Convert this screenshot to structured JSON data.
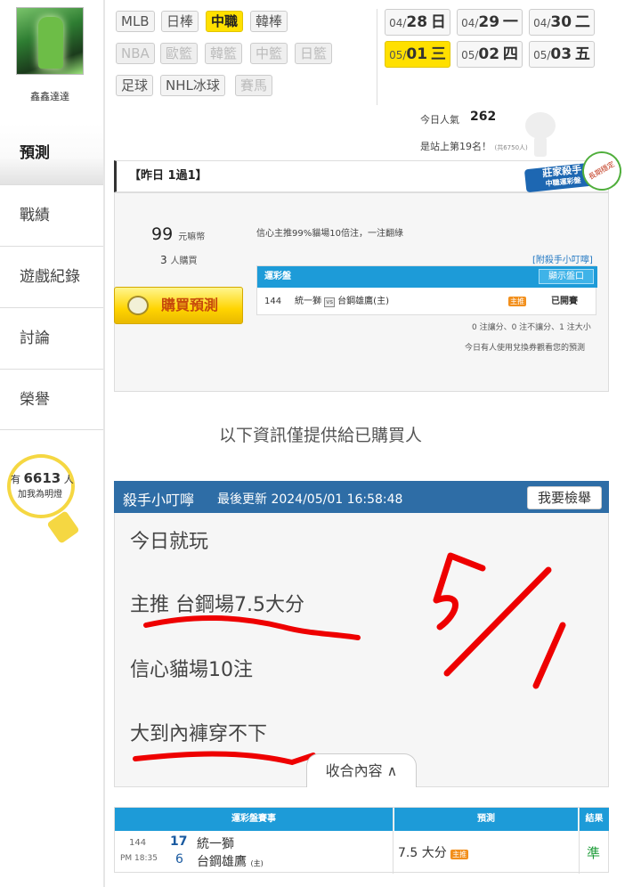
{
  "user": {
    "name": "鑫鑫達達"
  },
  "nav": [
    {
      "label": "預測"
    },
    {
      "label": "戰績"
    },
    {
      "label": "遊戲紀錄"
    },
    {
      "label": "討論"
    },
    {
      "label": "榮譽"
    }
  ],
  "lamp": {
    "prefix": "有",
    "count": "6613",
    "suffix": "人",
    "line2": "加我為明燈"
  },
  "sports": [
    "MLB",
    "日棒",
    "中職",
    "韓棒",
    "NBA",
    "歐籃",
    "韓籃",
    "中籃",
    "日籃",
    "足球",
    "NHL冰球",
    "賽馬"
  ],
  "dates": [
    {
      "md": "04/",
      "d": "28",
      "wd": "日"
    },
    {
      "md": "04/",
      "d": "29",
      "wd": "一"
    },
    {
      "md": "04/",
      "d": "30",
      "wd": "二"
    },
    {
      "md": "05/",
      "d": "01",
      "wd": "三"
    },
    {
      "md": "05/",
      "d": "02",
      "wd": "四"
    },
    {
      "md": "05/",
      "d": "03",
      "wd": "五"
    }
  ],
  "stats": {
    "pop_label": "今日人氣",
    "pop_value": "262",
    "rank_text": "是站上第19名！",
    "rank_sub": "(共6750人)"
  },
  "yesterday": "【昨日 1過1】",
  "badge": {
    "title": "莊家殺手",
    "sub": "中職運彩盤",
    "circle": "長期穩定"
  },
  "purchase": {
    "price": "99",
    "price_unit": "元嘛幣",
    "buyers": "3",
    "buyers_unit": "人購買",
    "button": "購買預測"
  },
  "pitch": "信心主推99%貓場10倍注，一注翻綠",
  "tip_link": "[附殺手小叮嚀]",
  "table1": {
    "header": "運彩盤",
    "toggle": "顯示盤口",
    "num": "144",
    "team_a": "統一獅",
    "vs": "vs",
    "team_b": "台鋼雄鷹(主)",
    "tag": "主推",
    "status": "已開賽"
  },
  "table1_foot": "0 注讓分、0 注不讓分、1 注大小",
  "table1_note": "今日有人使用兌換券觀看您的預測",
  "notice": "以下資訊僅提供給已購買人",
  "killer": {
    "title": "殺手小叮嚀",
    "updated": "最後更新 2024/05/01 16:58:48",
    "report": "我要檢舉",
    "lines": [
      "今日就玩",
      "主推 台鋼場7.5大分",
      "信心貓場10注",
      "大到內褲穿不下"
    ],
    "collapse": "收合內容 ∧",
    "handwriting": "5/1"
  },
  "table2": {
    "h_game": "運彩盤賽事",
    "h_pred": "預測",
    "h_result": "結果",
    "num": "144",
    "time": "PM 18:35",
    "score_a": "17",
    "score_b": "6",
    "team_a": "統一獅",
    "team_b": "台鋼雄鷹",
    "home": "(主)",
    "pred": "7.5 大分",
    "tag": "主推",
    "result": "準"
  }
}
